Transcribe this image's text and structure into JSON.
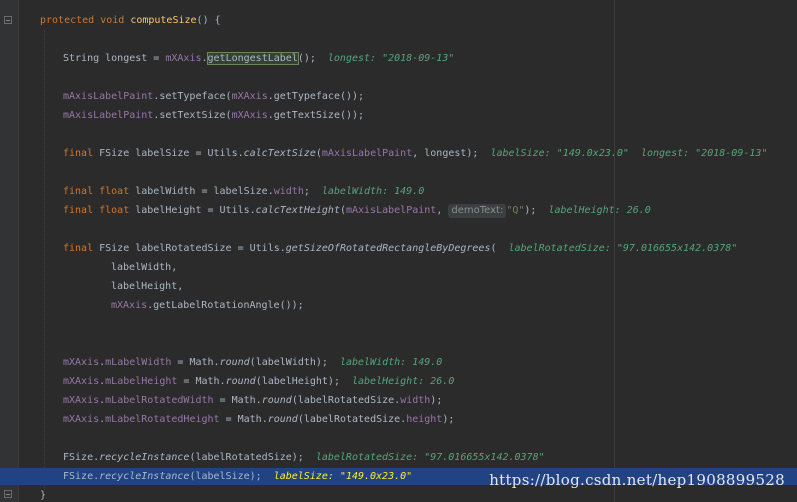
{
  "editor": {
    "signature": {
      "kw": "protected void ",
      "name": "computeSize",
      "rest": "() {"
    },
    "close_brace": "}",
    "l_longest": {
      "a": "String longest = ",
      "fld": "mXAxis",
      "dot": ".",
      "sel": "getLongestLabel",
      "b": "();",
      "hint": "longest: \"2018-09-13\""
    },
    "l_typeface": {
      "fld": "mAxisLabelPaint",
      "a": ".setTypeface(",
      "fld2": "mXAxis",
      "b": ".getTypeface());"
    },
    "l_textsize": {
      "fld": "mAxisLabelPaint",
      "a": ".setTextSize(",
      "fld2": "mXAxis",
      "b": ".getTextSize());"
    },
    "l_labelsize": {
      "kw": "final ",
      "a": "FSize labelSize = Utils.",
      "m": "calcTextSize",
      "b": "(",
      "fld": "mAxisLabelPaint",
      "c": ", longest);",
      "hint": "labelSize: \"149.0x23.0\"  longest: \"2018-09-13\""
    },
    "l_width": {
      "kw": "final float ",
      "a": "labelWidth = labelSize.",
      "fld": "width",
      "b": ";",
      "hint": "labelWidth: 149.0"
    },
    "l_height": {
      "kw": "final float ",
      "a": "labelHeight = Utils.",
      "m": "calcTextHeight",
      "b": "(",
      "fld": "mAxisLabelPaint",
      "c": ",",
      "param": "demoText:",
      "str": "\"Q\"",
      "d": ");",
      "hint": "labelHeight: 26.0"
    },
    "l_rot": {
      "kw": "final ",
      "a": "FSize labelRotatedSize = Utils.",
      "m": "getSizeOfRotatedRectangleByDegrees",
      "b": "(",
      "hint": "labelRotatedSize: \"97.016655x142.0378\""
    },
    "l_rot2": {
      "a": "labelWidth,"
    },
    "l_rot3": {
      "a": "labelHeight,"
    },
    "l_rot4": {
      "fld": "mXAxis",
      "a": ".getLabelRotationAngle());"
    },
    "l_mlw": {
      "fld": "mXAxis",
      "dot": ".",
      "fld2": "mLabelWidth",
      "a": " = Math.",
      "m": "round",
      "b": "(labelWidth);",
      "hint": "labelWidth: 149.0"
    },
    "l_mlh": {
      "fld": "mXAxis",
      "dot": ".",
      "fld2": "mLabelHeight",
      "a": " = Math.",
      "m": "round",
      "b": "(labelHeight);",
      "hint": "labelHeight: 26.0"
    },
    "l_mlrw": {
      "fld": "mXAxis",
      "dot": ".",
      "fld2": "mLabelRotatedWidth",
      "a": " = Math.",
      "m": "round",
      "b": "(labelRotatedSize.",
      "fld3": "width",
      "c": ");"
    },
    "l_mlrh": {
      "fld": "mXAxis",
      "dot": ".",
      "fld2": "mLabelRotatedHeight",
      "a": " = Math.",
      "m": "round",
      "b": "(labelRotatedSize.",
      "fld3": "height",
      "c": ");"
    },
    "l_rec1": {
      "a": "FSize.",
      "m": "recycleInstance",
      "b": "(labelRotatedSize);",
      "hint": "labelRotatedSize: \"97.016655x142.0378\""
    },
    "l_rec2": {
      "a": "FSize.",
      "m": "recycleInstance",
      "b": "(labelSize);",
      "hint": "labelSize: \"149.0x23.0\""
    }
  },
  "watermark": "https://blog.csdn.net/hep1908899528",
  "colors": {
    "background": "#2b2b2b",
    "keyword": "#cc7832",
    "field": "#9876aa",
    "debug_hint": "#56a57a",
    "current_line": "#214283"
  }
}
